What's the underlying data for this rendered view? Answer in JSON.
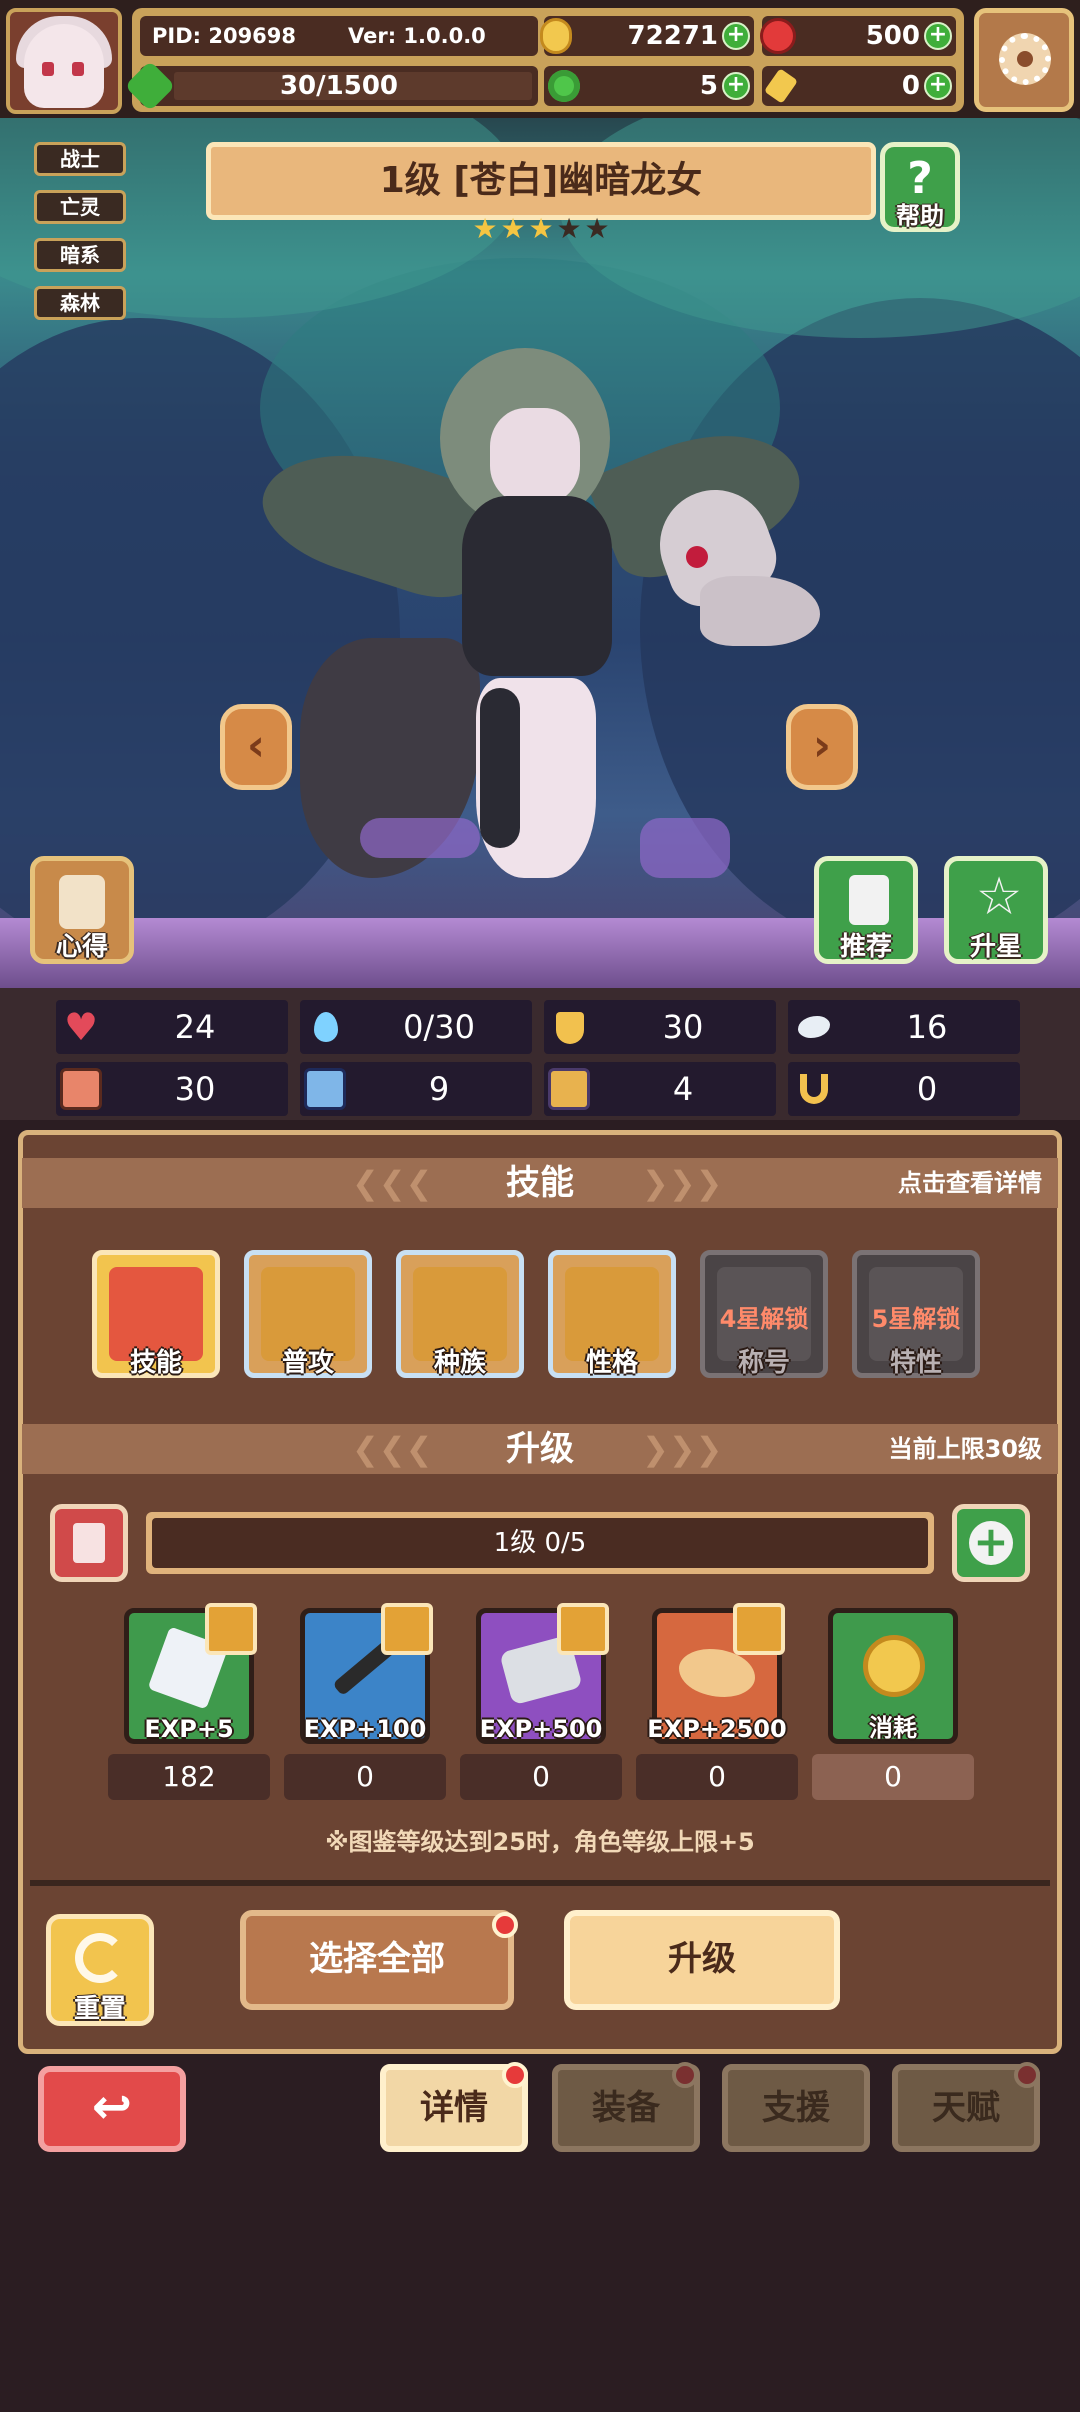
{
  "header": {
    "pid": "PID: 209698",
    "version": "Ver: 1.0.0.0",
    "gold": "72271",
    "gems": "500",
    "stamina": "30/1500",
    "clover": "5",
    "key": "0"
  },
  "tags": [
    "战士",
    "亡灵",
    "暗系",
    "森林"
  ],
  "character": {
    "title": "1级 [苍白]幽暗龙女",
    "stars_filled": 3,
    "stars_total": 5
  },
  "buttons": {
    "help": "帮助",
    "insight": "心得",
    "recommend": "推荐",
    "star_up": "升星"
  },
  "stats": [
    {
      "icon": "heart-icon",
      "value": "24",
      "color": "#e34a5a"
    },
    {
      "icon": "water-drop-icon",
      "value": "0/30",
      "color": "#7fd2ff"
    },
    {
      "icon": "shield-icon",
      "value": "30",
      "color": "#f2c14e"
    },
    {
      "icon": "wing-icon",
      "value": "16",
      "color": "#e8eef5"
    },
    {
      "icon": "fist-icon",
      "value": "30",
      "color": "#e8856a"
    },
    {
      "icon": "book-icon",
      "value": "9",
      "color": "#7fb6e8"
    },
    {
      "icon": "boot-icon",
      "value": "4",
      "color": "#e8b24e"
    },
    {
      "icon": "horseshoe-icon",
      "value": "0",
      "color": "#f2c14e"
    }
  ],
  "skills_section": {
    "title": "技能",
    "note": "点击查看详情",
    "items": [
      {
        "label": "技能",
        "icon": "skill-icon",
        "color": "#e4573f"
      },
      {
        "label": "普攻",
        "icon": "sword-icon",
        "color": "#d99a3a"
      },
      {
        "label": "种族",
        "icon": "dragon-head-icon",
        "color": "#d99a3a"
      },
      {
        "label": "性格",
        "icon": "scroll-icon",
        "color": "#d99a3a"
      },
      {
        "label": "称号",
        "icon": "locked-title-icon",
        "lock": "4星解锁"
      },
      {
        "label": "特性",
        "icon": "locked-trait-icon",
        "lock": "5星解锁"
      }
    ]
  },
  "upgrade_section": {
    "title": "升级",
    "note": "当前上限30级",
    "level_text": "1级  0/5",
    "items": [
      {
        "label": "EXP+5",
        "count": "182",
        "color": "#3f9a4c",
        "icon": "white-crystal-icon"
      },
      {
        "label": "EXP+100",
        "count": "0",
        "color": "#3c84c8",
        "icon": "quill-icon"
      },
      {
        "label": "EXP+500",
        "count": "0",
        "color": "#8e4fc0",
        "icon": "silver-crystal-icon"
      },
      {
        "label": "EXP+2500",
        "count": "0",
        "color": "#d6683f",
        "icon": "golden-dragon-icon"
      },
      {
        "label": "消耗",
        "count": "0",
        "color": "#3f9a4c",
        "icon": "gold-coin-icon"
      }
    ],
    "note_text": "※图鉴等级达到25时，角色等级上限+5"
  },
  "actions": {
    "reset": "重置",
    "select_all": "选择全部",
    "upgrade": "升级"
  },
  "tabs": [
    "详情",
    "装备",
    "支援",
    "天赋"
  ]
}
